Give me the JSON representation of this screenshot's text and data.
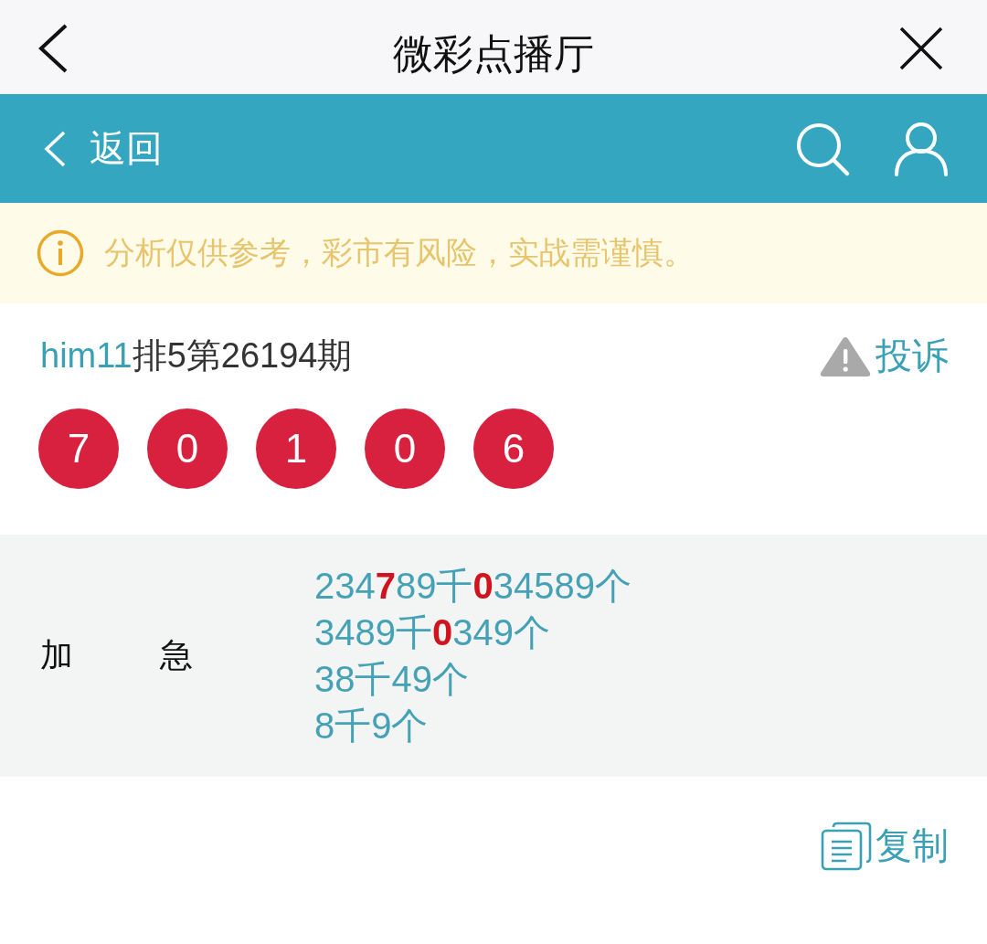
{
  "nav": {
    "title": "微彩点播厅"
  },
  "toolbar": {
    "back_label": "返回"
  },
  "notice": {
    "text": "分析仅供参考，彩市有风险，实战需谨慎。"
  },
  "issue": {
    "user": "him11",
    "title": "排5第26194期",
    "report_label": "投诉",
    "balls": [
      "7",
      "0",
      "1",
      "0",
      "6"
    ]
  },
  "prediction": {
    "label_chars": [
      "加",
      "急"
    ],
    "lines": [
      "234**7**89千**0**34589个",
      "3489千**0**349个",
      "38千49个",
      "8千9个"
    ]
  },
  "copy": {
    "label": "复制"
  }
}
